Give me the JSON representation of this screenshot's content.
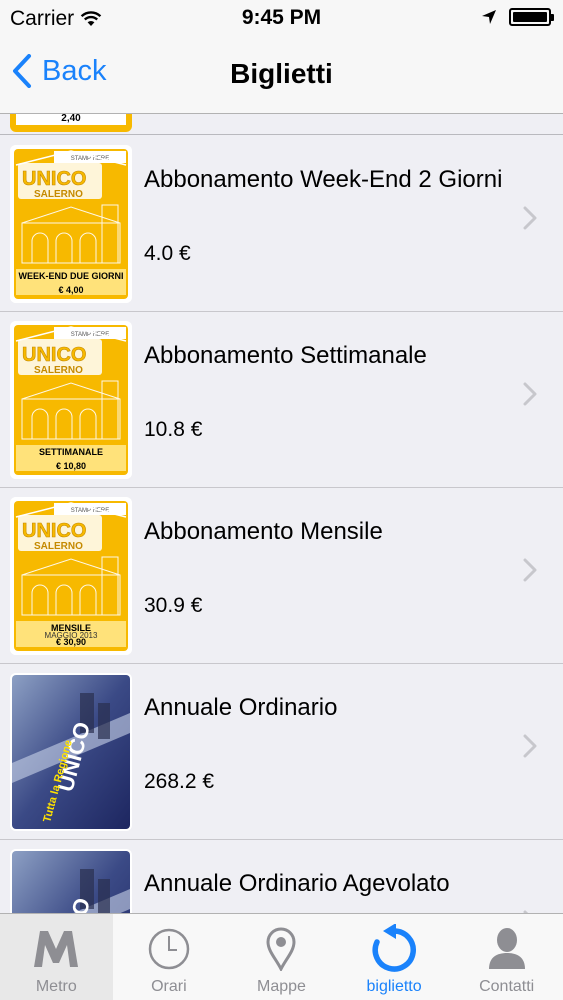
{
  "status_bar": {
    "carrier": "Carrier",
    "time": "9:45 PM"
  },
  "nav": {
    "back_label": "Back",
    "title": "Biglietti"
  },
  "partial_row": {
    "ticket_price_text": "2,40"
  },
  "tickets": [
    {
      "title": "Abbonamento Week-End 2 Giorni",
      "price": "4.0 €",
      "thumb_style": "yellow",
      "thumb_line1": "WEEK-END DUE GIORNI",
      "thumb_line2": "€ 4,00"
    },
    {
      "title": "Abbonamento Settimanale",
      "price": "10.8 €",
      "thumb_style": "yellow",
      "thumb_line1": "SETTIMANALE",
      "thumb_line2": "€ 10,80"
    },
    {
      "title": "Abbonamento Mensile",
      "price": "30.9 €",
      "thumb_style": "yellow",
      "thumb_line1": "MENSILE",
      "thumb_line2": "€ 30,90",
      "thumb_line0": "MAGGIO 2013"
    },
    {
      "title": "Annuale Ordinario",
      "price": "268.2 €",
      "thumb_style": "photo"
    },
    {
      "title": "Annuale Ordinario Agevolato",
      "price": "",
      "thumb_style": "photo"
    }
  ],
  "thumb_brand": {
    "name": "UNICO",
    "city": "SALERNO",
    "stamp": "STAMP HERE"
  },
  "tabs": [
    {
      "label": "Metro",
      "icon": "metro-icon"
    },
    {
      "label": "Orari",
      "icon": "clock-icon"
    },
    {
      "label": "Mappe",
      "icon": "map-pin-icon"
    },
    {
      "label": "biglietto",
      "icon": "refresh-icon"
    },
    {
      "label": "Contatti",
      "icon": "contact-icon"
    }
  ],
  "colors": {
    "accent": "#1a82fb",
    "ticket_yellow": "#f7b900",
    "tab_inactive": "#8e8e93"
  }
}
